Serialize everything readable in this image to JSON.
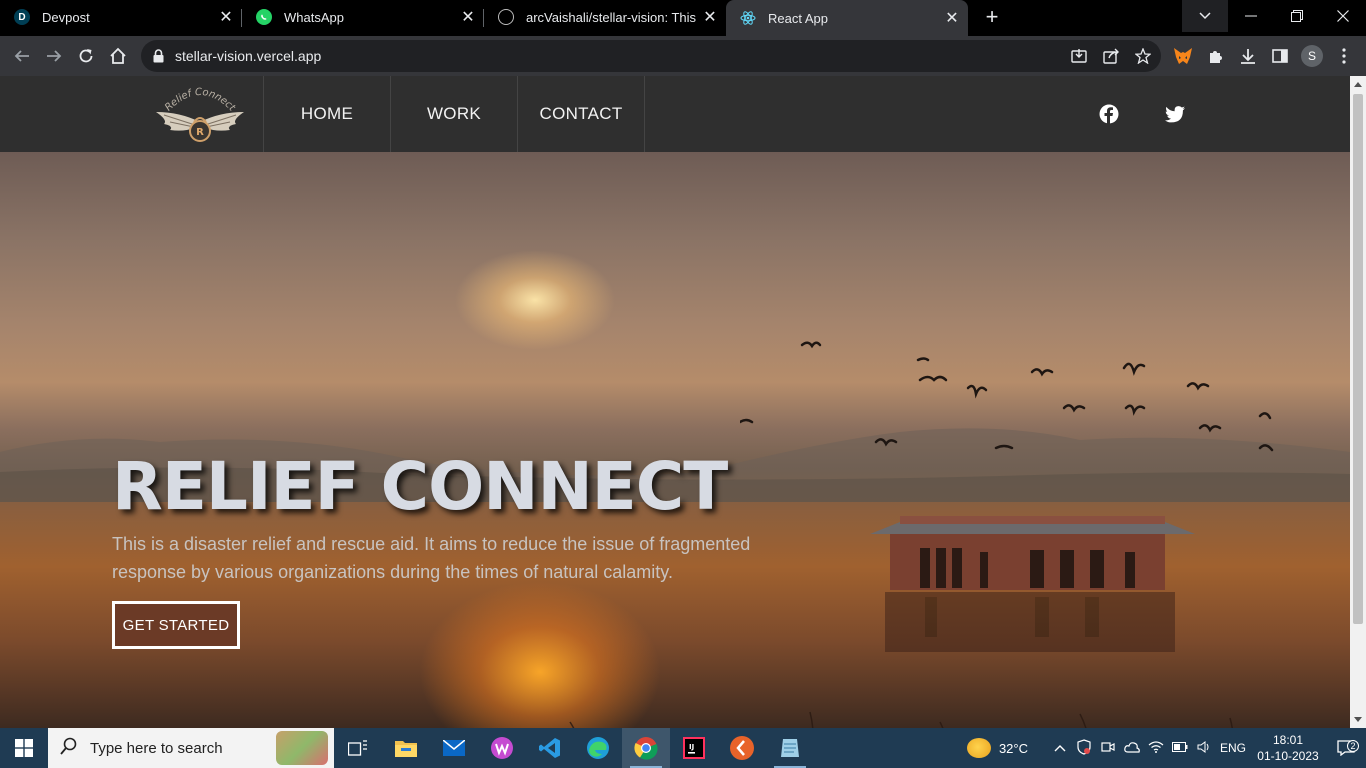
{
  "browser": {
    "tabs": [
      {
        "title": "Devpost",
        "favicon": "devpost-favicon",
        "favicon_letter": "D",
        "active": false
      },
      {
        "title": "WhatsApp",
        "favicon": "whatsapp-favicon",
        "active": false
      },
      {
        "title": "arcVaishali/stellar-vision: This is a",
        "favicon": "github-favicon",
        "active": false
      },
      {
        "title": "React App",
        "favicon": "react-favicon",
        "active": true
      }
    ],
    "url": "stellar-vision.vercel.app",
    "profile_initial": "S"
  },
  "site": {
    "logo_text": "Relief Connect",
    "logo_letter": "R",
    "nav": [
      {
        "label": "HOME"
      },
      {
        "label": "WORK"
      },
      {
        "label": "CONTACT"
      }
    ],
    "social": [
      "facebook-icon",
      "twitter-icon"
    ],
    "hero": {
      "title": "RELIEF CONNECT",
      "description": "This is a disaster relief and rescue aid. It aims to reduce the issue of fragmented response by various organizations during the times of natural calamity.",
      "cta_label": "GET STARTED"
    }
  },
  "taskbar": {
    "search_placeholder": "Type here to search",
    "temperature": "32°C",
    "language": "ENG",
    "time": "18:01",
    "date": "01-10-2023",
    "notification_count": "2"
  },
  "colors": {
    "nav_bg": "#2f2f2f",
    "cta_bg": "#6b3a26",
    "taskbar_bg": "#1f3b53",
    "hero_title": "#d7dbe3"
  }
}
